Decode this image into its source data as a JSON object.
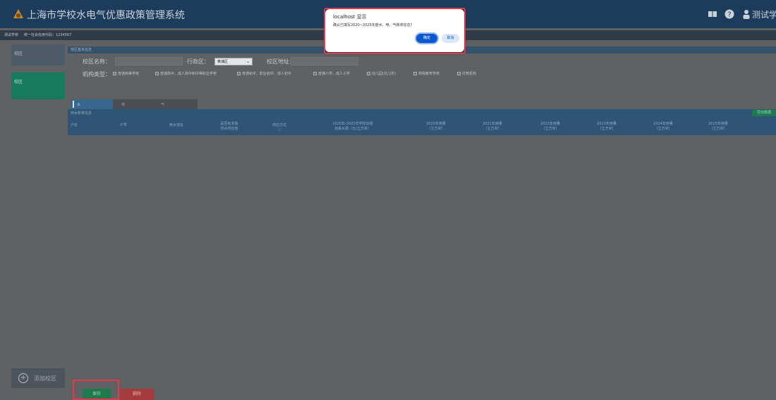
{
  "header": {
    "title": "上海市学校水电气优惠政策管理系统",
    "user_name": "测试学校"
  },
  "info_bar": {
    "school_label": "测试学校",
    "credit_code": "统一社会信用代码：1234567"
  },
  "sidebar": {
    "items": [
      {
        "label": "校区"
      },
      {
        "label": "校区"
      }
    ],
    "add_label": "添加校区"
  },
  "form": {
    "section_title": "校区基本信息",
    "campus_name_label": "校区名称：",
    "campus_name_value": "",
    "district_label": "行政区：",
    "district_value": "黄浦区",
    "campus_address_label": "校区地址：",
    "campus_address_value": "",
    "institution_label": "机构类型：",
    "institution_types": [
      "普通高等学校",
      "普通高中、成人高中和中等职业学校",
      "普通初中、职业初中、成人初中",
      "普通小学、成人小学",
      "幼儿园(托儿所)",
      "特殊教育学校",
      "托育机构"
    ]
  },
  "tabs": [
    {
      "label": "水"
    },
    {
      "label": "电"
    },
    {
      "label": "气"
    }
  ],
  "table": {
    "title": "用水账单信息",
    "import_label": "导出数据",
    "headers": [
      "户名",
      "户号",
      "用水地址",
      "是否有单独 供水供应商",
      "供应方式 ⓘ",
      "2020年-2025年学校出租 自来水费（元/立方米）",
      "2020年用量 （立方米）",
      "2021年用量 （立方米）",
      "2022年用量 （立方米）",
      "2023年用量 （立方米）",
      "2024年用量 （立方米）",
      "2025年用量 （立方米）"
    ]
  },
  "footer": {
    "save_label": "保存",
    "delete_label": "删除"
  },
  "dialog": {
    "title": "localhost 显示",
    "message": "确认已填写2020~2025年度水、电、气账单信息?",
    "ok_label": "确定",
    "cancel_label": "取消"
  },
  "colors": {
    "header_bg": "#1d3c5c",
    "accent_green": "#1e7a4d",
    "accent_red": "#a53b3d",
    "dialog_ok": "#0b57d0",
    "highlight": "#e3394b"
  }
}
